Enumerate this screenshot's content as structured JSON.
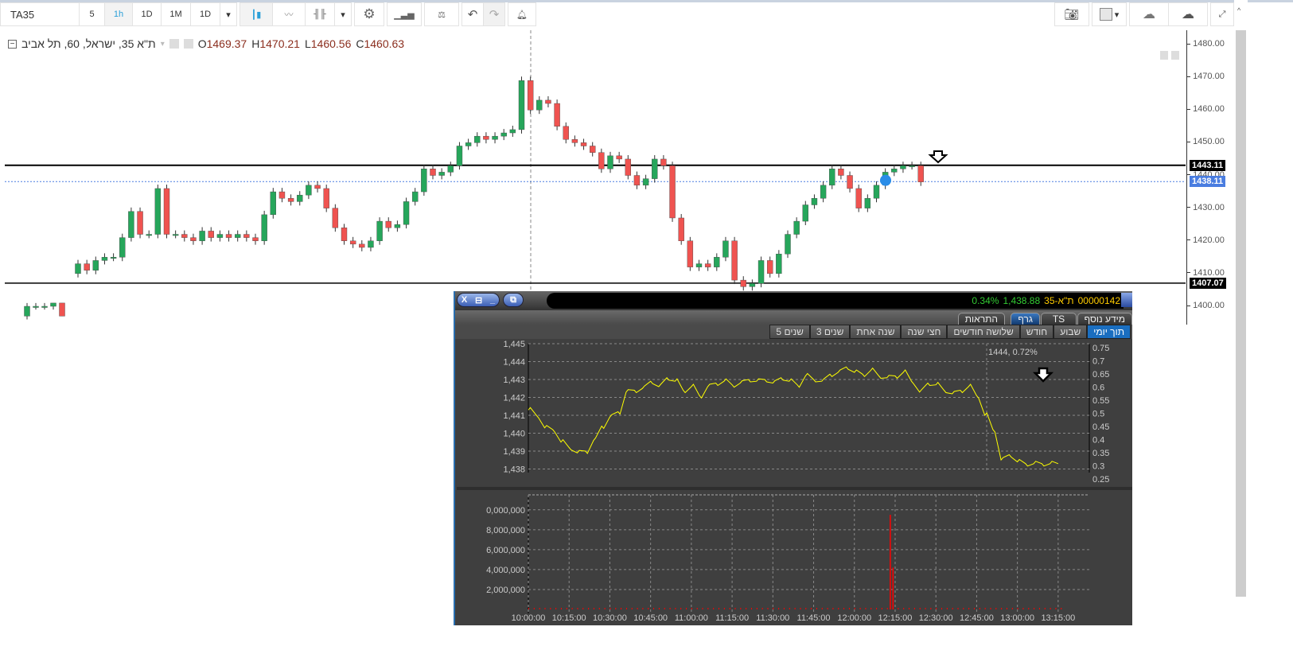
{
  "toolbar": {
    "symbol": "TA35",
    "intervals": [
      "5",
      "1h",
      "1D",
      "1M",
      "1D"
    ],
    "active_interval": "1h"
  },
  "legend": {
    "title": "ת\"א 35, ישראל, 60, תל אביב",
    "o_label": "O",
    "o": "1469.37",
    "h_label": "H",
    "h": "1470.21",
    "l_label": "L",
    "l": "1460.56",
    "c_label": "C",
    "c": "1460.63"
  },
  "price_axis": {
    "ticks": [
      "1480.00",
      "1470.00",
      "1460.00",
      "1450.00",
      "1440.00",
      "1430.00",
      "1420.00",
      "1410.00",
      "1400.00"
    ],
    "labels": {
      "upper_line": "1443.11",
      "last": "1438.11",
      "lower_line": "1407.07"
    }
  },
  "colors": {
    "up": "#26a65b",
    "down": "#ef5350",
    "last": "#4a7de0",
    "line": "#ffff00",
    "volume": "#ff0000"
  },
  "candles_closes": [
    1413,
    1411,
    1414,
    1415,
    1415,
    1421,
    1429,
    1422,
    1422,
    1436,
    1422,
    1422,
    1421,
    1420,
    1423,
    1421,
    1422,
    1421,
    1422,
    1421,
    1420,
    1428,
    1435,
    1433,
    1432,
    1434,
    1437,
    1436,
    1430,
    1424,
    1420,
    1419,
    1418,
    1420,
    1426,
    1424,
    1425,
    1432,
    1435,
    1442,
    1440,
    1441,
    1443,
    1449,
    1450,
    1452,
    1451,
    1452,
    1453,
    1454,
    1469,
    1460,
    1463,
    1462,
    1455,
    1451,
    1450,
    1449,
    1447,
    1442,
    1446,
    1445,
    1440,
    1437,
    1439,
    1445,
    1443,
    1427,
    1420,
    1412,
    1413,
    1412,
    1415,
    1420,
    1408,
    1406,
    1407,
    1414,
    1410,
    1416,
    1422,
    1426,
    1431,
    1433,
    1437,
    1442,
    1440,
    1436,
    1430,
    1433,
    1437,
    1441,
    1442,
    1443,
    1443,
    1438
  ],
  "early_candles": [
    [
      1397,
      1401,
      1396,
      1400
    ],
    [
      1400,
      1401,
      1399,
      1400
    ],
    [
      1400,
      1401,
      1399,
      1400
    ],
    [
      1400,
      1401,
      1399,
      1401
    ],
    [
      1401,
      1401,
      1397,
      1397
    ]
  ],
  "inset": {
    "buttons": [
      "X",
      "⊟",
      "_",
      "⧉"
    ],
    "ticker": {
      "id": "00000142",
      "name": "ת\"א-35",
      "price": "1,438.88",
      "change": "0.34%"
    },
    "tabs": [
      "מידע נוסף",
      "TS",
      "גרף",
      "התראות"
    ],
    "active_tab": "גרף",
    "periods": [
      "תוך יומי",
      "שבוע",
      "חודש",
      "שלושה חודשים",
      "חצי שנה",
      "שנה אחת",
      "3 שנים",
      "5 שנים"
    ],
    "active_period": "תוך יומי",
    "crosshair_label": "1444, 0.72%",
    "chart_data": [
      {
        "type": "line",
        "title": "",
        "y_ticks": [
          "1,445",
          "1,444",
          "1,443",
          "1,442",
          "1,441",
          "1,440",
          "1,439",
          "1,438"
        ],
        "y2_ticks": [
          "0.75",
          "0.7",
          "0.65",
          "0.6",
          "0.55",
          "0.5",
          "0.45",
          "0.4",
          "0.35",
          "0.3",
          "0.25"
        ],
        "ylim": [
          1437.8,
          1445
        ],
        "x_minutes": [
          0,
          3,
          6,
          9,
          12,
          15,
          18,
          21,
          24,
          27,
          30,
          33,
          36,
          39,
          42,
          45,
          48,
          51,
          54,
          57,
          60,
          63,
          66,
          69,
          72,
          75,
          78,
          81,
          84,
          87,
          90,
          93,
          96,
          99,
          102,
          105,
          108,
          111,
          114,
          117,
          120,
          123,
          126,
          129,
          132,
          135,
          138,
          141,
          144,
          147,
          150,
          153,
          156,
          159,
          162,
          165,
          168,
          171,
          174,
          177,
          180,
          183,
          186,
          189,
          192,
          195
        ],
        "values": [
          1441.3,
          1441.0,
          1440.3,
          1440.2,
          1439.5,
          1439.2,
          1438.9,
          1439.0,
          1439.6,
          1440.4,
          1440.9,
          1441.2,
          1442.3,
          1442.4,
          1442.5,
          1442.9,
          1442.6,
          1443.1,
          1442.9,
          1442.4,
          1442.6,
          1442.1,
          1442.6,
          1442.8,
          1442.9,
          1442.7,
          1442.8,
          1443.0,
          1442.9,
          1443.0,
          1442.8,
          1443.1,
          1442.9,
          1442.7,
          1443.2,
          1443.0,
          1442.9,
          1443.3,
          1443.4,
          1443.7,
          1443.4,
          1443.3,
          1443.5,
          1443.2,
          1443.1,
          1443.2,
          1443.4,
          1442.9,
          1442.3,
          1442.8,
          1442.7,
          1442.4,
          1442.2,
          1442.4,
          1442.6,
          1442.1,
          1441.0,
          1440.2,
          1438.5,
          1438.8,
          1438.4,
          1438.3,
          1438.3,
          1438.3,
          1438.3,
          1438.3
        ]
      },
      {
        "type": "bar",
        "name": "volume",
        "y_ticks": [
          "0,000,000",
          "8,000,000",
          "6,000,000",
          "4,000,000",
          "2,000,000"
        ],
        "ylim": [
          0,
          11500000
        ],
        "x_ticks": [
          "10:00:00",
          "10:15:00",
          "10:30:00",
          "10:45:00",
          "11:00:00",
          "11:15:00",
          "11:30:00",
          "11:45:00",
          "12:00:00",
          "12:15:00",
          "12:30:00",
          "12:45:00",
          "13:00:00",
          "13:15:00"
        ],
        "spikes": [
          {
            "minute": 133,
            "value": 9500000
          },
          {
            "minute": 134,
            "value": 4200000
          }
        ]
      }
    ]
  }
}
